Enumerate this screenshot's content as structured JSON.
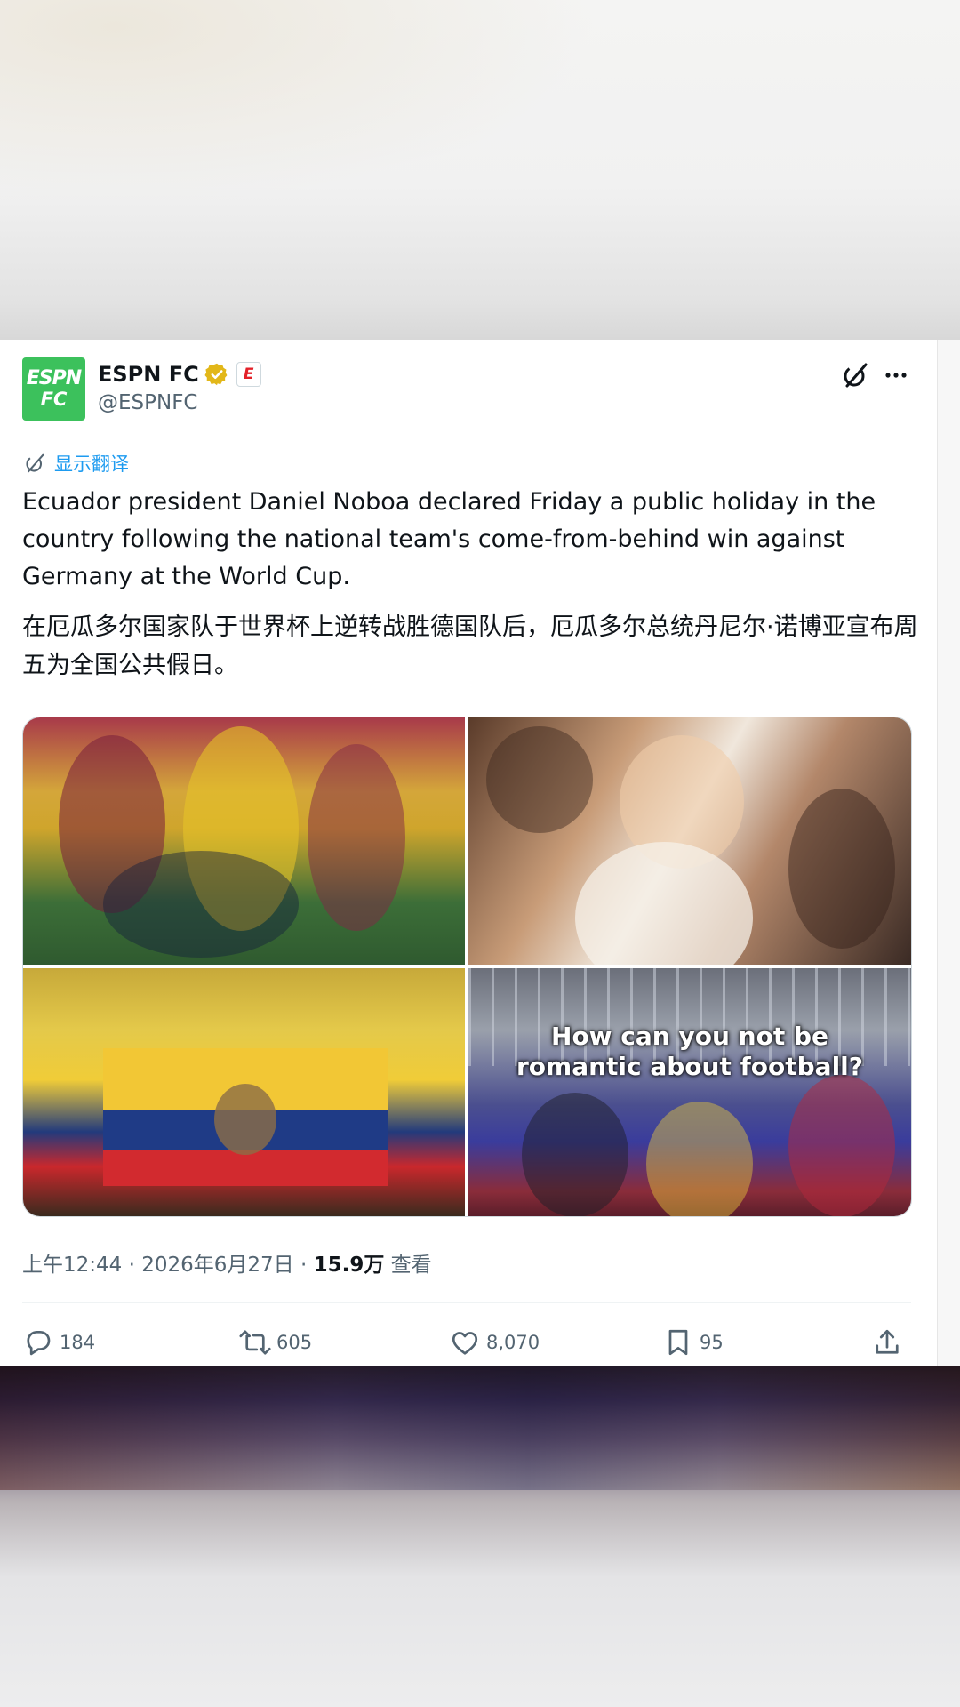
{
  "post": {
    "author": {
      "name": "ESPN FC",
      "handle": "@ESPNFC",
      "avatar_text_line1": "ESPN",
      "avatar_text_line2": "FC",
      "affiliate_badge": "E",
      "verified_color": "#e2b719",
      "avatar_color": "#3cc15c"
    },
    "translate_label": "显示翻译",
    "text": "Ecuador president Daniel Noboa declared Friday a public holiday in the country following the national team's come-from-behind win against Germany at the World Cup.",
    "translated_text": "在厄瓜多尔国家队于世界杯上逆转战胜德国队后，厄瓜多尔总统丹尼尔·诺博亚宣布周五为全国公共假日。",
    "media": {
      "overlay_caption_line1": "How can you not be",
      "overlay_caption_line2": "romantic about football?"
    },
    "meta": {
      "time": "上午12:44",
      "separator": " · ",
      "date": "2026年6月27日",
      "views_count": "15.9万",
      "views_label": " 查看"
    },
    "actions": {
      "replies": "184",
      "reposts": "605",
      "likes": "8,070",
      "bookmarks": "95"
    }
  },
  "colors": {
    "link": "#1d9bf0",
    "text": "#0f1419",
    "secondary": "#536471"
  }
}
